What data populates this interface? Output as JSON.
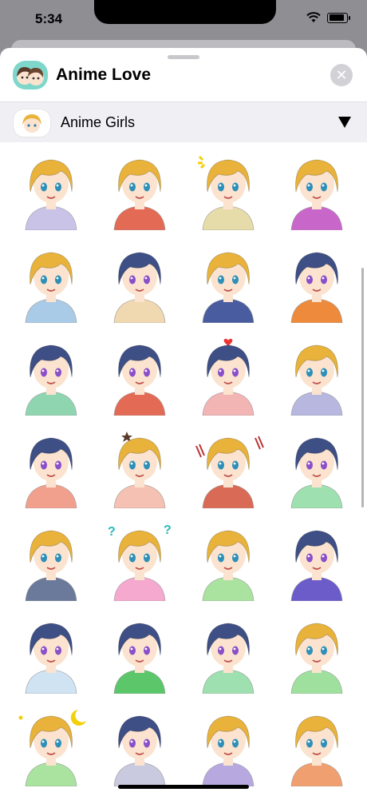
{
  "status_bar": {
    "time": "5:34"
  },
  "header": {
    "title": "Anime Love",
    "close_icon": "xmark-circle-icon"
  },
  "pack": {
    "name": "Anime Girls",
    "dropdown_icon": "triangle-down-icon"
  },
  "colors": {
    "blonde_hair": "#e9b33b",
    "blue_hair": "#3e4f86",
    "skin": "#fbe3cf",
    "app_icon_bg": "#7fd7cc"
  },
  "stickers": [
    {
      "hair": "blonde",
      "shirt": "#c9c3e8",
      "mark": ""
    },
    {
      "hair": "blonde",
      "shirt": "#e36a55",
      "mark": ""
    },
    {
      "hair": "blonde",
      "shirt": "#e6dca9",
      "mark": "sparkle"
    },
    {
      "hair": "blonde",
      "shirt": "#c867c9",
      "mark": ""
    },
    {
      "hair": "blonde",
      "shirt": "#a9cbe8",
      "mark": ""
    },
    {
      "hair": "blue",
      "shirt": "#f0d8b0",
      "mark": ""
    },
    {
      "hair": "blonde",
      "shirt": "#4a5ca0",
      "mark": ""
    },
    {
      "hair": "blue",
      "shirt": "#ee8a3b",
      "mark": ""
    },
    {
      "hair": "blue",
      "shirt": "#8fd6b0",
      "mark": ""
    },
    {
      "hair": "blue",
      "shirt": "#e36a55",
      "mark": ""
    },
    {
      "hair": "blue",
      "shirt": "#f3b4b4",
      "mark": "heart"
    },
    {
      "hair": "blonde",
      "shirt": "#b7b7e0",
      "mark": ""
    },
    {
      "hair": "blue",
      "shirt": "#f2a08e",
      "mark": ""
    },
    {
      "hair": "blonde",
      "shirt": "#f5c1b3",
      "mark": "star"
    },
    {
      "hair": "blonde",
      "shirt": "#d96a55",
      "mark": "lines"
    },
    {
      "hair": "blue",
      "shirt": "#9fe0b0",
      "mark": ""
    },
    {
      "hair": "blonde",
      "shirt": "#6b7a9a",
      "mark": ""
    },
    {
      "hair": "blonde",
      "shirt": "#f5a9cf",
      "mark": "question"
    },
    {
      "hair": "blonde",
      "shirt": "#a9e39f",
      "mark": ""
    },
    {
      "hair": "blue",
      "shirt": "#6b5cc9",
      "mark": ""
    },
    {
      "hair": "blue",
      "shirt": "#cfe3f3",
      "mark": ""
    },
    {
      "hair": "blue",
      "shirt": "#5cc76a",
      "mark": ""
    },
    {
      "hair": "blue",
      "shirt": "#9fe0b0",
      "mark": ""
    },
    {
      "hair": "blonde",
      "shirt": "#9fe09f",
      "mark": ""
    },
    {
      "hair": "blonde",
      "shirt": "#a9e39f",
      "mark": "moon"
    },
    {
      "hair": "blue",
      "shirt": "#c9c9e0",
      "mark": ""
    },
    {
      "hair": "blonde",
      "shirt": "#b7a9e0",
      "mark": ""
    },
    {
      "hair": "blonde",
      "shirt": "#f0a070",
      "mark": ""
    }
  ]
}
